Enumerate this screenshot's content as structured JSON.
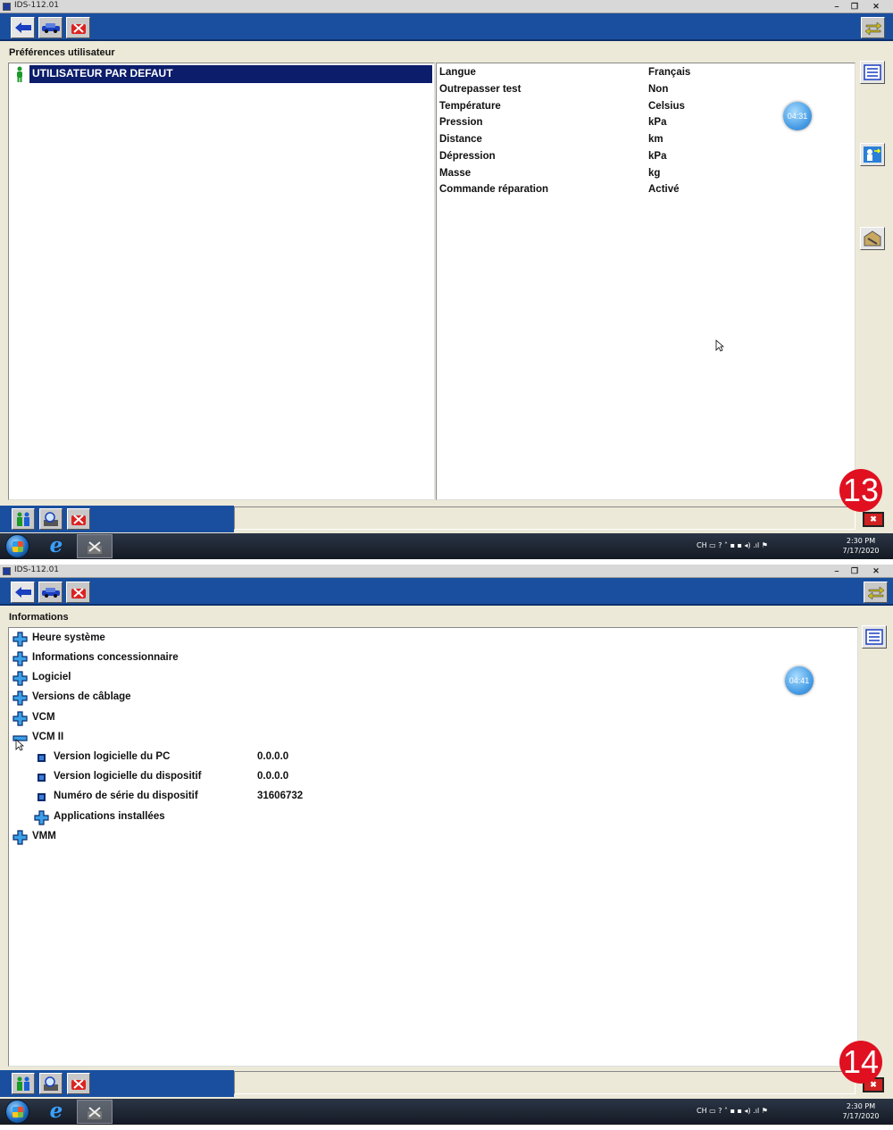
{
  "window": {
    "title": "IDS-112.01",
    "minimize": "–",
    "maximize": "❐",
    "close": "✕"
  },
  "screen1": {
    "page_title": "Préférences utilisateur",
    "user_selected": "UTILISATEUR PAR DEFAUT",
    "preferences": [
      {
        "key": "Langue",
        "value": "Français"
      },
      {
        "key": "Outrepasser test",
        "value": "Non"
      },
      {
        "key": "Température",
        "value": "Celsius"
      },
      {
        "key": "Pression",
        "value": "kPa"
      },
      {
        "key": "Distance",
        "value": "km"
      },
      {
        "key": "Dépression",
        "value": "kPa"
      },
      {
        "key": "Masse",
        "value": "kg"
      },
      {
        "key": "Commande réparation",
        "value": "Activé"
      }
    ],
    "timer": "04:31",
    "badge": "13",
    "clock_time": "2:30 PM",
    "clock_date": "7/17/2020"
  },
  "screen2": {
    "page_title": "Informations",
    "tree": [
      {
        "label": "Heure système",
        "state": "collapsed"
      },
      {
        "label": "Informations concessionnaire",
        "state": "collapsed"
      },
      {
        "label": "Logiciel",
        "state": "collapsed"
      },
      {
        "label": "Versions de câblage",
        "state": "collapsed"
      },
      {
        "label": "VCM",
        "state": "collapsed"
      },
      {
        "label": "VCM II",
        "state": "expanded"
      },
      {
        "label": "Version logicielle du PC",
        "value": "0.0.0.0",
        "state": "leaf"
      },
      {
        "label": "Version logicielle du dispositif",
        "value": "0.0.0.0",
        "state": "leaf"
      },
      {
        "label": "Numéro de série du dispositif",
        "value": "31606732",
        "state": "leaf"
      },
      {
        "label": "Applications installées",
        "state": "collapsed"
      },
      {
        "label": "VMM",
        "state": "collapsed"
      }
    ],
    "timer": "04:41",
    "badge": "14",
    "clock_time": "2:30 PM",
    "clock_date": "7/17/2020"
  },
  "taskbar": {
    "tray_lang": "CH",
    "tray_icons": "▭ ? ˄ ▪ ▪ ◂) .ıl ⚑"
  },
  "colors": {
    "toolbar_blue": "#1a4fa0",
    "selection_navy": "#0b1d6b",
    "badge_red": "#e01020",
    "timer_blue": "#4a9fe6"
  }
}
